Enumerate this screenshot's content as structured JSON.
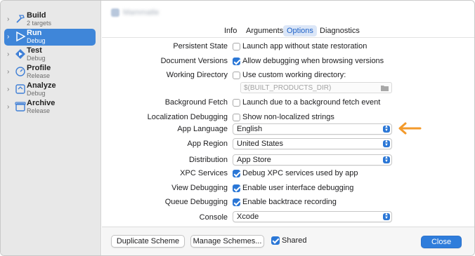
{
  "sidebar": {
    "items": [
      {
        "title": "Build",
        "subtitle": "2 targets"
      },
      {
        "title": "Run",
        "subtitle": "Debug"
      },
      {
        "title": "Test",
        "subtitle": "Debug"
      },
      {
        "title": "Profile",
        "subtitle": "Release"
      },
      {
        "title": "Analyze",
        "subtitle": "Debug"
      },
      {
        "title": "Archive",
        "subtitle": "Release"
      }
    ],
    "selected": "Run"
  },
  "header": {
    "title_blurred": "Mammatle"
  },
  "tabs": [
    "Info",
    "Arguments",
    "Options",
    "Diagnostics"
  ],
  "active_tab": "Options",
  "options": {
    "persistent_state": {
      "label": "Persistent State",
      "text": "Launch app without state restoration",
      "checked": false
    },
    "document_versions": {
      "label": "Document Versions",
      "text": "Allow debugging when browsing versions",
      "checked": true
    },
    "working_directory": {
      "label": "Working Directory",
      "text": "Use custom working directory:",
      "checked": false,
      "path_placeholder": "$(BUILT_PRODUCTS_DIR)"
    },
    "background_fetch": {
      "label": "Background Fetch",
      "text": "Launch due to a background fetch event",
      "checked": false
    },
    "localization_debugging": {
      "label": "Localization Debugging",
      "text": "Show non-localized strings",
      "checked": false
    },
    "app_language": {
      "label": "App Language",
      "value": "English"
    },
    "app_region": {
      "label": "App Region",
      "value": "United States"
    },
    "distribution": {
      "label": "Distribution",
      "value": "App Store"
    },
    "xpc_services": {
      "label": "XPC Services",
      "text": "Debug XPC services used by app",
      "checked": true
    },
    "view_debugging": {
      "label": "View Debugging",
      "text": "Enable user interface debugging",
      "checked": true
    },
    "queue_debugging": {
      "label": "Queue Debugging",
      "text": "Enable backtrace recording",
      "checked": true
    },
    "console": {
      "label": "Console",
      "value": "Xcode"
    }
  },
  "footer": {
    "duplicate": "Duplicate Scheme",
    "manage": "Manage Schemes...",
    "shared": "Shared",
    "shared_checked": true,
    "close": "Close"
  },
  "colors": {
    "accent": "#2f7ddb",
    "arrow": "#f39a2b",
    "sidebar_bg": "#e8e8e8"
  }
}
